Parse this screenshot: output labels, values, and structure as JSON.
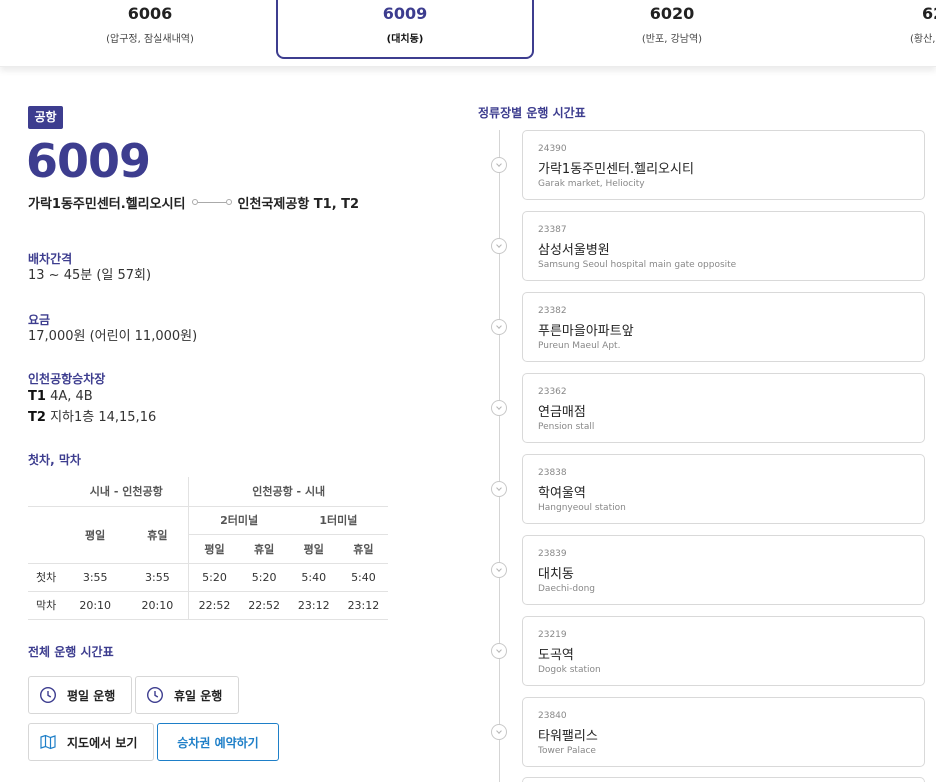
{
  "route_tabs": [
    {
      "number": "6006",
      "sub": "(압구정, 잠실새내역)"
    },
    {
      "number": "6009",
      "sub": "(대치동)"
    },
    {
      "number": "6020",
      "sub": "(반포, 강남역)"
    },
    {
      "number": "62",
      "sub": "(황산,"
    }
  ],
  "route": {
    "badge": "공항",
    "number": "6009",
    "start": "가락1동주민센터.헬리오시티",
    "end": "인천국제공항 T1, T2"
  },
  "interval": {
    "title": "배차간격",
    "value": "13 ~ 45분 (일 57회)"
  },
  "fare": {
    "title": "요금",
    "value": "17,000원 (어린이 11,000원)"
  },
  "airport_stop": {
    "title": "인천공항승차장",
    "t1_label": "T1",
    "t1_value": "4A, 4B",
    "t2_label": "T2",
    "t2_value": "지하1층 14,15,16"
  },
  "first_last": {
    "title": "첫차, 막차",
    "header_city_airport": "시내 - 인천공항",
    "header_airport_city": "인천공항 - 시내",
    "weekday": "평일",
    "holiday": "휴일",
    "terminal2": "2터미널",
    "terminal1": "1터미널",
    "rows": [
      {
        "label": "첫차",
        "values": [
          "3:55",
          "3:55",
          "5:20",
          "5:20",
          "5:40",
          "5:40"
        ]
      },
      {
        "label": "막차",
        "values": [
          "20:10",
          "20:10",
          "22:52",
          "22:52",
          "23:12",
          "23:12"
        ]
      }
    ]
  },
  "full_schedule": {
    "title": "전체 운행 시간표",
    "weekday_button": "평일 운행",
    "holiday_button": "휴일 운행",
    "map_button": "지도에서 보기",
    "reserve_button": "승차권 예약하기"
  },
  "stops_title": "정류장별 운행 시간표",
  "stops": [
    {
      "id": "24390",
      "name": "가락1동주민센터.헬리오시티",
      "en": "Garak market, Heliocity"
    },
    {
      "id": "23387",
      "name": "삼성서울병원",
      "en": "Samsung Seoul hospital main gate opposite"
    },
    {
      "id": "23382",
      "name": "푸른마을아파트앞",
      "en": "Pureun Maeul Apt."
    },
    {
      "id": "23362",
      "name": "연금매점",
      "en": "Pension stall"
    },
    {
      "id": "23838",
      "name": "학여울역",
      "en": "Hangnyeoul station"
    },
    {
      "id": "23839",
      "name": "대치동",
      "en": "Daechi-dong"
    },
    {
      "id": "23219",
      "name": "도곡역",
      "en": "Dogok station"
    },
    {
      "id": "23840",
      "name": "타워팰리스",
      "en": "Tower Palace"
    }
  ],
  "colors": {
    "accent": "#3d3d8f",
    "link_blue": "#1e7fc8"
  }
}
